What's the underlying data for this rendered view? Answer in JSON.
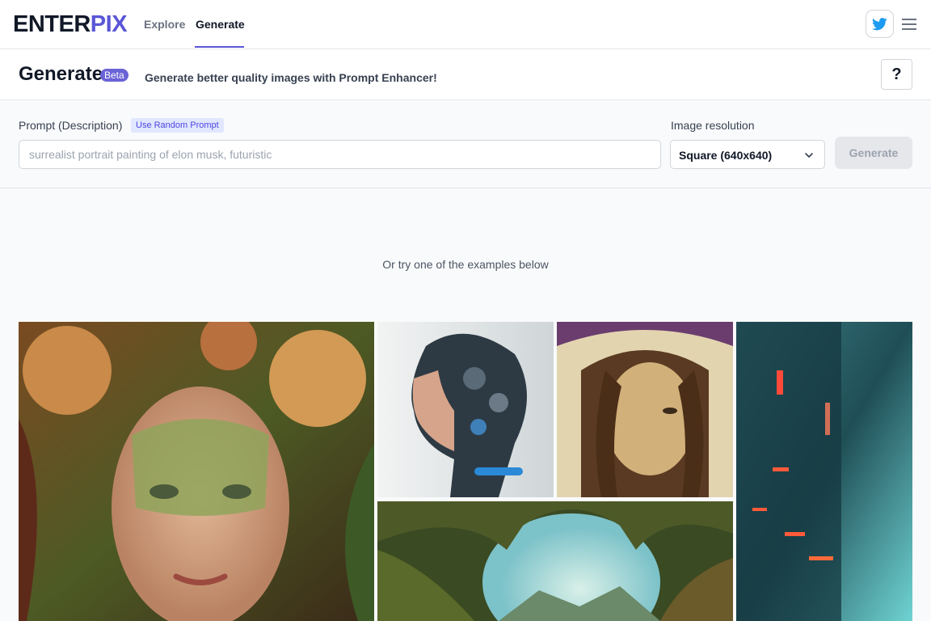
{
  "nav": {
    "logo_part1": "ENTER",
    "logo_part2": "PIX",
    "links": [
      {
        "label": "Explore"
      },
      {
        "label": "Generate"
      }
    ],
    "icons": [
      "twitter-icon",
      "hamburger-menu-icon"
    ]
  },
  "header": {
    "title": "Generate",
    "badge": "Beta",
    "subtitle": "Generate better quality images with Prompt Enhancer!",
    "help_label": "?"
  },
  "form": {
    "prompt_label": "Prompt (Description)",
    "random_label": "Use Random Prompt",
    "prompt_placeholder": "surrealist portrait painting of elon musk, futuristic",
    "prompt_value": "",
    "resolution_label": "Image resolution",
    "resolution_value": "Square (640x640)",
    "generate_label": "Generate"
  },
  "examples_text": "Or try one of the examples below",
  "colors": {
    "brand": "#5a56d6",
    "twitter": "#1d9bf0",
    "button_disabled": "#e5e7eb"
  }
}
